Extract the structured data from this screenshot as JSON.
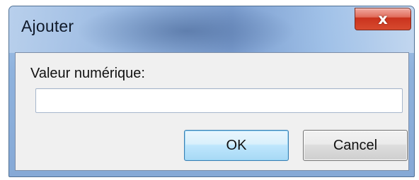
{
  "window": {
    "title": "Ajouter",
    "close_icon": "close-icon",
    "close_glyph": "x"
  },
  "form": {
    "label": "Valeur numérique:",
    "input_value": "",
    "input_placeholder": ""
  },
  "buttons": {
    "ok_label": "OK",
    "cancel_label": "Cancel"
  },
  "colors": {
    "titlebar": "#8fb2dd",
    "close_button": "#c9321d",
    "ok_button_border": "#3c7fb1"
  }
}
